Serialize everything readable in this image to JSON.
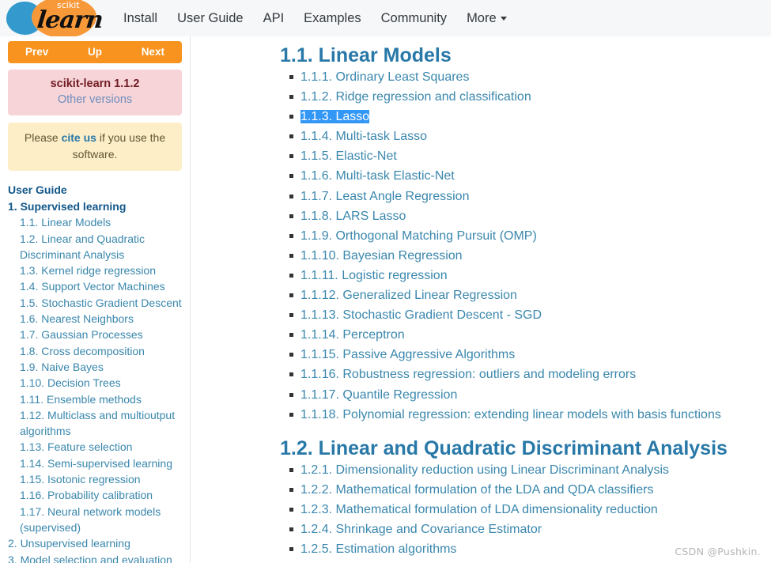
{
  "header": {
    "logo": {
      "scikit": "scikit",
      "learn": "learn"
    },
    "nav": [
      {
        "label": "Install"
      },
      {
        "label": "User Guide"
      },
      {
        "label": "API"
      },
      {
        "label": "Examples"
      },
      {
        "label": "Community"
      },
      {
        "label": "More"
      }
    ]
  },
  "sidebar": {
    "relbar": {
      "prev": "Prev",
      "up": "Up",
      "next": "Next"
    },
    "version": {
      "title": "scikit-learn 1.1.2",
      "other": "Other versions"
    },
    "cite": {
      "before": "Please ",
      "link": "cite us",
      "after": " if you use the software."
    },
    "toc_caption": "User Guide",
    "toc": [
      {
        "label": "1. Supervised learning",
        "level": 1,
        "bold": true
      },
      {
        "label": "1.1. Linear Models",
        "level": 2
      },
      {
        "label": "1.2. Linear and Quadratic Discriminant Analysis",
        "level": 2
      },
      {
        "label": "1.3. Kernel ridge regression",
        "level": 2
      },
      {
        "label": "1.4. Support Vector Machines",
        "level": 2
      },
      {
        "label": "1.5. Stochastic Gradient Descent",
        "level": 2
      },
      {
        "label": "1.6. Nearest Neighbors",
        "level": 2
      },
      {
        "label": "1.7. Gaussian Processes",
        "level": 2
      },
      {
        "label": "1.8. Cross decomposition",
        "level": 2
      },
      {
        "label": "1.9. Naive Bayes",
        "level": 2
      },
      {
        "label": "1.10. Decision Trees",
        "level": 2
      },
      {
        "label": "1.11. Ensemble methods",
        "level": 2
      },
      {
        "label": "1.12. Multiclass and multioutput algorithms",
        "level": 2
      },
      {
        "label": "1.13. Feature selection",
        "level": 2
      },
      {
        "label": "1.14. Semi-supervised learning",
        "level": 2
      },
      {
        "label": "1.15. Isotonic regression",
        "level": 2
      },
      {
        "label": "1.16. Probability calibration",
        "level": 2
      },
      {
        "label": "1.17. Neural network models (supervised)",
        "level": 2
      },
      {
        "label": "2. Unsupervised learning",
        "level": 1,
        "bold": false
      },
      {
        "label": "3. Model selection and evaluation",
        "level": 1,
        "bold": false
      }
    ]
  },
  "main": {
    "sections": [
      {
        "heading": "1.1. Linear Models",
        "items": [
          {
            "label": "1.1.1. Ordinary Least Squares",
            "selected": false
          },
          {
            "label": "1.1.2. Ridge regression and classification",
            "selected": false
          },
          {
            "label": "1.1.3. Lasso",
            "selected": true
          },
          {
            "label": "1.1.4. Multi-task Lasso",
            "selected": false
          },
          {
            "label": "1.1.5. Elastic-Net",
            "selected": false
          },
          {
            "label": "1.1.6. Multi-task Elastic-Net",
            "selected": false
          },
          {
            "label": "1.1.7. Least Angle Regression",
            "selected": false
          },
          {
            "label": "1.1.8. LARS Lasso",
            "selected": false
          },
          {
            "label": "1.1.9. Orthogonal Matching Pursuit (OMP)",
            "selected": false
          },
          {
            "label": "1.1.10. Bayesian Regression",
            "selected": false
          },
          {
            "label": "1.1.11. Logistic regression",
            "selected": false
          },
          {
            "label": "1.1.12. Generalized Linear Regression",
            "selected": false
          },
          {
            "label": "1.1.13. Stochastic Gradient Descent - SGD",
            "selected": false
          },
          {
            "label": "1.1.14. Perceptron",
            "selected": false
          },
          {
            "label": "1.1.15. Passive Aggressive Algorithms",
            "selected": false
          },
          {
            "label": "1.1.16. Robustness regression: outliers and modeling errors",
            "selected": false
          },
          {
            "label": "1.1.17. Quantile Regression",
            "selected": false
          },
          {
            "label": "1.1.18. Polynomial regression: extending linear models with basis functions",
            "selected": false
          }
        ]
      },
      {
        "heading": "1.2. Linear and Quadratic Discriminant Analysis",
        "items": [
          {
            "label": "1.2.1. Dimensionality reduction using Linear Discriminant Analysis",
            "selected": false
          },
          {
            "label": "1.2.2. Mathematical formulation of the LDA and QDA classifiers",
            "selected": false
          },
          {
            "label": "1.2.3. Mathematical formulation of LDA dimensionality reduction",
            "selected": false
          },
          {
            "label": "1.2.4. Shrinkage and Covariance Estimator",
            "selected": false
          },
          {
            "label": "1.2.5. Estimation algorithms",
            "selected": false
          }
        ]
      }
    ]
  },
  "watermark": "CSDN @Pushkin."
}
